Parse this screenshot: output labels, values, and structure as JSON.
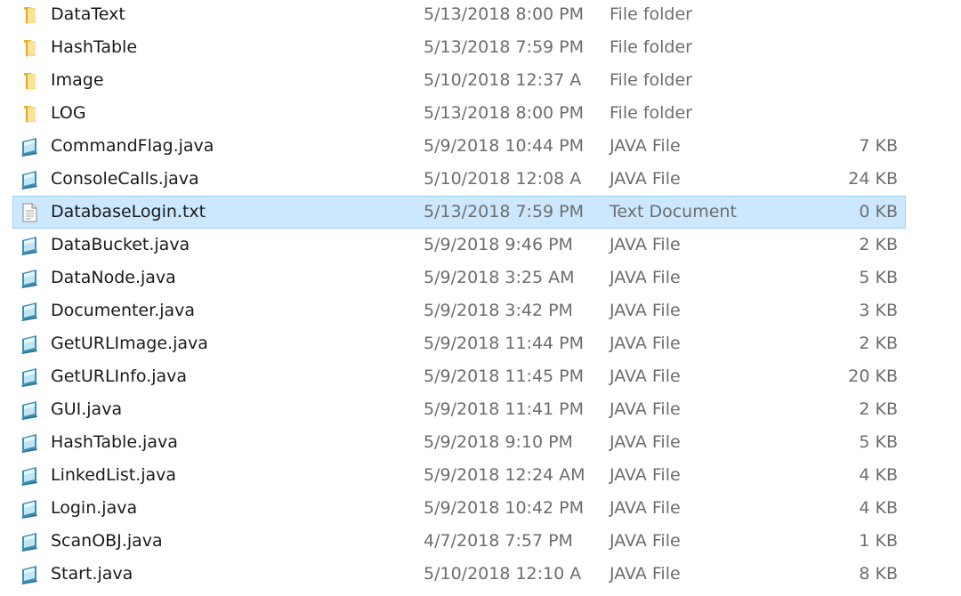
{
  "files": [
    {
      "name": "DataText",
      "date": "5/13/2018 8:00 PM",
      "type": "File folder",
      "size": "",
      "icon": "folder-icon"
    },
    {
      "name": "HashTable",
      "date": "5/13/2018 7:59 PM",
      "type": "File folder",
      "size": "",
      "icon": "folder-icon"
    },
    {
      "name": "Image",
      "date": "5/10/2018 12:37 A",
      "type": "File folder",
      "size": "",
      "icon": "folder-icon"
    },
    {
      "name": "LOG",
      "date": "5/13/2018 8:00 PM",
      "type": "File folder",
      "size": "",
      "icon": "folder-icon"
    },
    {
      "name": "CommandFlag.java",
      "date": "5/9/2018 10:44 PM",
      "type": "JAVA File",
      "size": "7 KB",
      "icon": "java-file-icon"
    },
    {
      "name": "ConsoleCalls.java",
      "date": "5/10/2018 12:08 A",
      "type": "JAVA File",
      "size": "24 KB",
      "icon": "java-file-icon"
    },
    {
      "name": "DatabaseLogin.txt",
      "date": "5/13/2018 7:59 PM",
      "type": "Text Document",
      "size": "0 KB",
      "icon": "text-document-icon",
      "selected": true
    },
    {
      "name": "DataBucket.java",
      "date": "5/9/2018 9:46 PM",
      "type": "JAVA File",
      "size": "2 KB",
      "icon": "java-file-icon"
    },
    {
      "name": "DataNode.java",
      "date": "5/9/2018 3:25 AM",
      "type": "JAVA File",
      "size": "5 KB",
      "icon": "java-file-icon"
    },
    {
      "name": "Documenter.java",
      "date": "5/9/2018 3:42 PM",
      "type": "JAVA File",
      "size": "3 KB",
      "icon": "java-file-icon"
    },
    {
      "name": "GetURLImage.java",
      "date": "5/9/2018 11:44 PM",
      "type": "JAVA File",
      "size": "2 KB",
      "icon": "java-file-icon"
    },
    {
      "name": "GetURLInfo.java",
      "date": "5/9/2018 11:45 PM",
      "type": "JAVA File",
      "size": "20 KB",
      "icon": "java-file-icon"
    },
    {
      "name": "GUI.java",
      "date": "5/9/2018 11:41 PM",
      "type": "JAVA File",
      "size": "2 KB",
      "icon": "java-file-icon"
    },
    {
      "name": "HashTable.java",
      "date": "5/9/2018 9:10 PM",
      "type": "JAVA File",
      "size": "5 KB",
      "icon": "java-file-icon"
    },
    {
      "name": "LinkedList.java",
      "date": "5/9/2018 12:24 AM",
      "type": "JAVA File",
      "size": "4 KB",
      "icon": "java-file-icon"
    },
    {
      "name": "Login.java",
      "date": "5/9/2018 10:42 PM",
      "type": "JAVA File",
      "size": "4 KB",
      "icon": "java-file-icon"
    },
    {
      "name": "ScanOBJ.java",
      "date": "4/7/2018 7:57 PM",
      "type": "JAVA File",
      "size": "1 KB",
      "icon": "java-file-icon"
    },
    {
      "name": "Start.java",
      "date": "5/10/2018 12:10 A",
      "type": "JAVA File",
      "size": "8 KB",
      "icon": "java-file-icon"
    }
  ],
  "colors": {
    "selection_background": "#cce8ff",
    "selection_border": "#99d1ff",
    "name_text": "#1a1a1a",
    "detail_text": "#6d6d6d",
    "folder": "#f8d775"
  }
}
